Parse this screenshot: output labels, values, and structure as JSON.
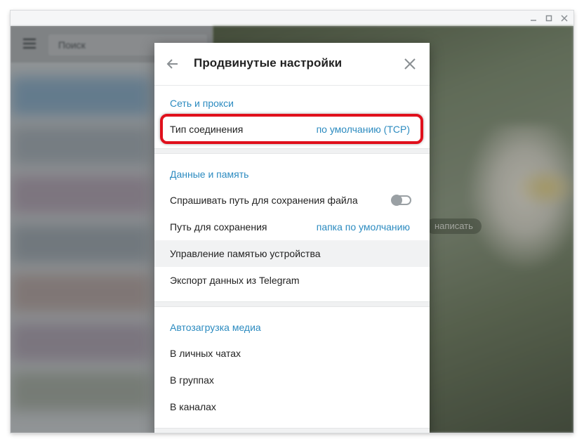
{
  "background_app": {
    "search_placeholder": "Поиск",
    "write_hint": "написать"
  },
  "modal": {
    "title": "Продвинутые настройки",
    "network_section": {
      "title": "Сеть и прокси",
      "connection_type": {
        "label": "Тип соединения",
        "value": "по умолчанию (TCP)"
      }
    },
    "data_section": {
      "title": "Данные и память",
      "ask_path": {
        "label": "Спрашивать путь для сохранения файла",
        "enabled": false
      },
      "save_path": {
        "label": "Путь для сохранения",
        "value": "папка по умолчанию"
      },
      "storage": {
        "label": "Управление памятью устройства"
      },
      "export": {
        "label": "Экспорт данных из Telegram"
      }
    },
    "autodownload_section": {
      "title": "Автозагрузка медиа",
      "items": [
        {
          "label": "В личных чатах"
        },
        {
          "label": "В группах"
        },
        {
          "label": "В каналах"
        }
      ]
    }
  },
  "colors": {
    "accent": "#2c8bc0",
    "highlight": "#e0101c"
  }
}
